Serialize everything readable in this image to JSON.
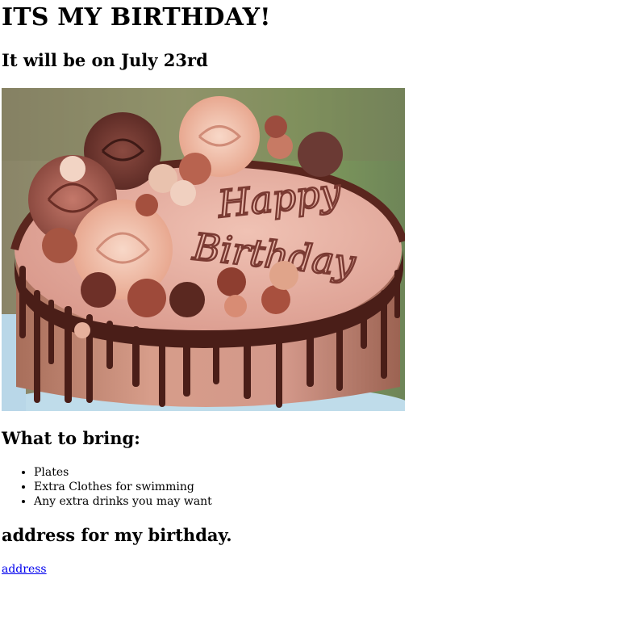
{
  "page": {
    "title": "ITS MY BIRTHDAY!",
    "subtitle": "It will be on July 23rd"
  },
  "cake_image": {
    "inscription_line1": "Happy",
    "inscription_line2": "Birthday"
  },
  "bring": {
    "heading": "What to bring:",
    "items": [
      "Plates",
      "Extra Clothes for swimming",
      "Any extra drinks you may want"
    ]
  },
  "address": {
    "heading": "address for my birthday.",
    "link_label": "address"
  }
}
